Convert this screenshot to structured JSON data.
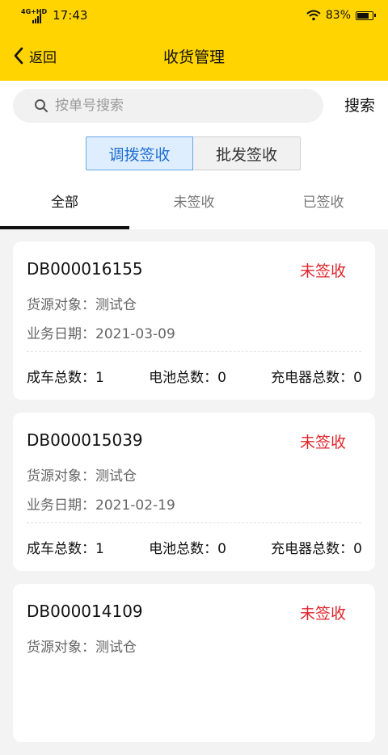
{
  "status_bar": {
    "network": "4G+HD",
    "time": "17:43",
    "battery_text": "83%",
    "battery_level": 0.83
  },
  "nav": {
    "back_label": "返回",
    "title": "收货管理"
  },
  "search": {
    "placeholder": "按单号搜索",
    "value": "",
    "button_label": "搜索"
  },
  "segments": [
    {
      "label": "调拨签收",
      "active": true
    },
    {
      "label": "批发签收",
      "active": false
    }
  ],
  "tabs": [
    {
      "label": "全部",
      "active": true
    },
    {
      "label": "未签收",
      "active": false
    },
    {
      "label": "已签收",
      "active": false
    }
  ],
  "labels": {
    "source": "货源对象：",
    "date": "业务日期：",
    "cars": "成车总数：",
    "battery": "电池总数：",
    "charger": "充电器总数："
  },
  "orders": [
    {
      "no": "DB000016155",
      "status": "未签收",
      "source": "测试仓",
      "date": "2021-03-09",
      "cars": "1",
      "battery": "0",
      "charger": "0"
    },
    {
      "no": "DB000015039",
      "status": "未签收",
      "source": "测试仓",
      "date": "2021-02-19",
      "cars": "1",
      "battery": "0",
      "charger": "0"
    },
    {
      "no": "DB000014109",
      "status": "未签收",
      "source": "测试仓",
      "date": "",
      "cars": "",
      "battery": "",
      "charger": ""
    }
  ],
  "colors": {
    "brand_yellow": "#ffd400",
    "status_red": "#e0242b",
    "segment_blue": "#1f6fd1"
  }
}
